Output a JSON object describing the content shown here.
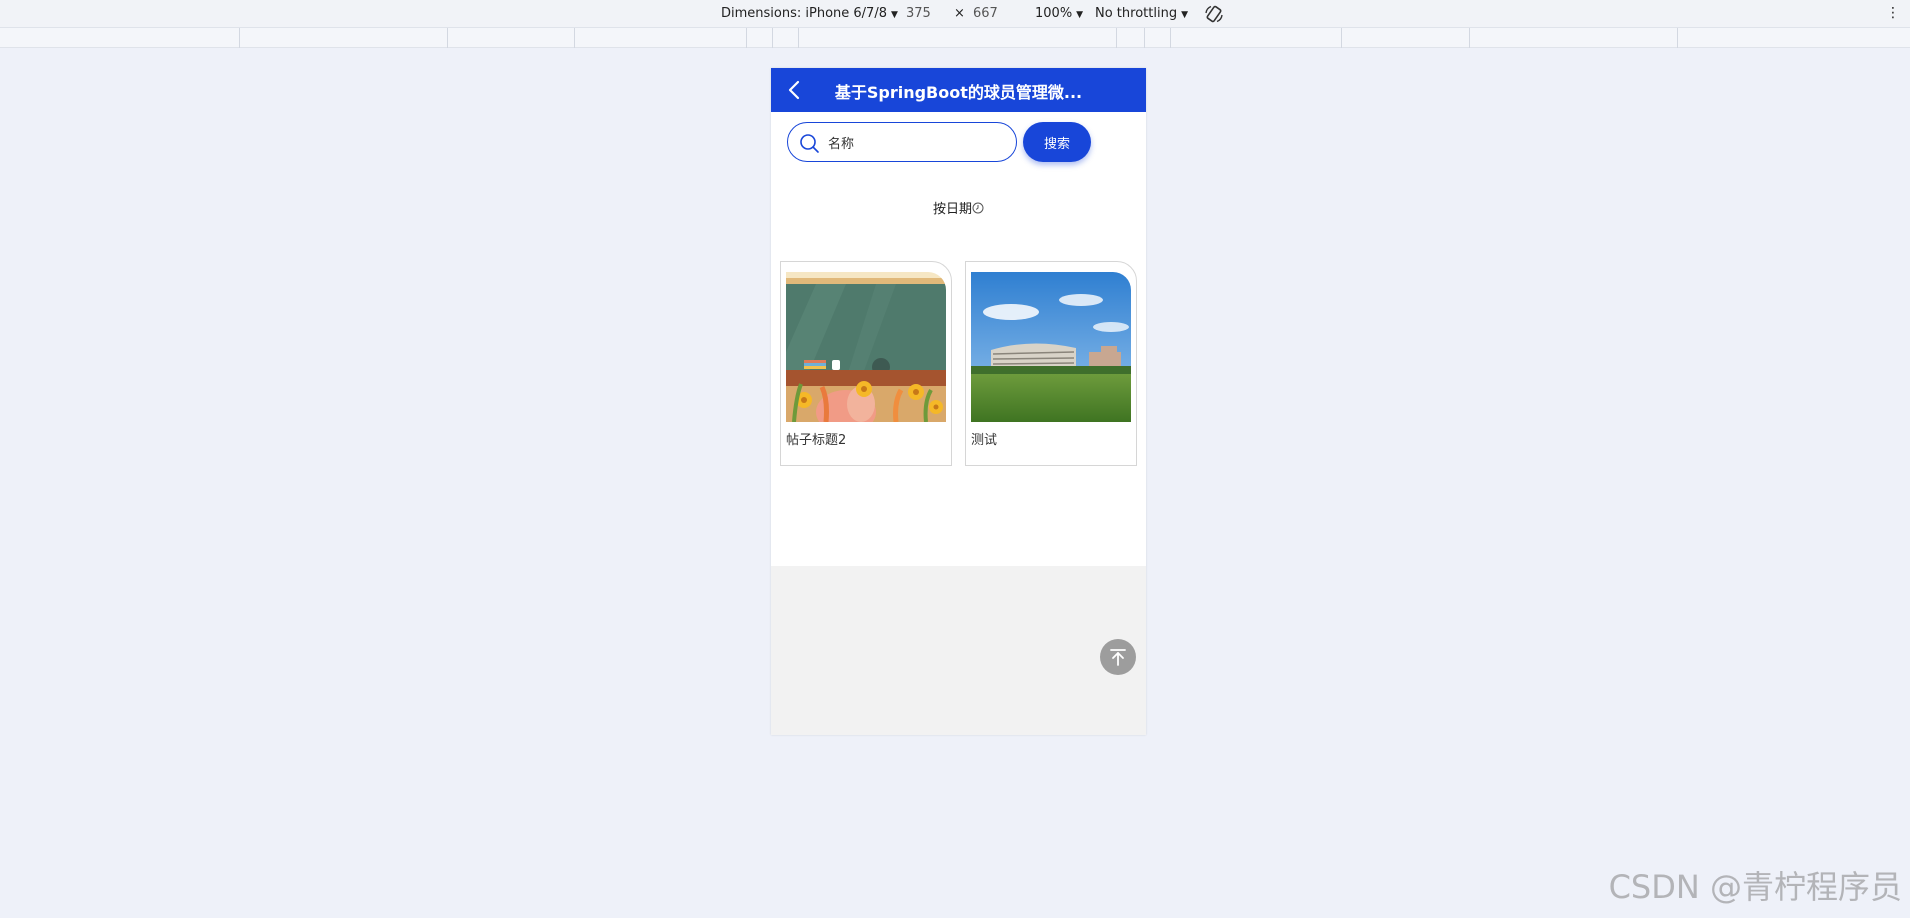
{
  "devtools": {
    "dimensions_label": "Dimensions: iPhone 6/7/8",
    "width": "375",
    "times": "×",
    "height": "667",
    "zoom": "100%",
    "throttling": "No throttling"
  },
  "app": {
    "title": "基于SpringBoot的球员管理微...",
    "accent": "#1846d9"
  },
  "search": {
    "value": "名称",
    "button_label": "搜索"
  },
  "sort_label": "按日期",
  "cards": [
    {
      "title": "帖子标题2"
    },
    {
      "title": "测试"
    }
  ],
  "watermark": "CSDN @青柠程序员"
}
